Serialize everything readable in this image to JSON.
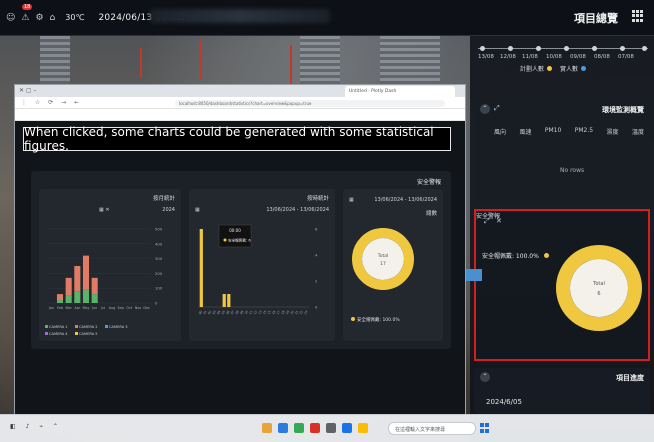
{
  "topbar": {
    "notification_count": "18",
    "weather": "30℃",
    "datetime": "2024/06/13 06:09PM",
    "project_title": "項目總覽"
  },
  "timeline": {
    "labels": [
      "07/08",
      "08/08",
      "09/08",
      "10/08",
      "11/08",
      "12/08",
      "13/08"
    ],
    "legend_a": "計劃人數",
    "legend_b": "實人數"
  },
  "env_card": {
    "title": "環境監測概覽",
    "tabs": [
      "風向",
      "風速",
      "PM10",
      "PM2.5",
      "濕度",
      "溫度"
    ],
    "empty_text": "No rows"
  },
  "safety_card": {
    "title": "安全警報",
    "legend": "安全帽佩戴: 100.0%",
    "center_label": "Total",
    "center_value": "6"
  },
  "progress_card": {
    "title": "項目進度",
    "date": "2024/6/05"
  },
  "browser": {
    "tab_title": "Untitled · Plotly Dash",
    "url": "localhost:8050/dashboard/statistics?chart=overview&popup=true"
  },
  "caption": "When clicked, some charts could be generated with some statistical figures.",
  "stats_panel": {
    "title": "安全警報",
    "card1": {
      "header": "總數",
      "range": "13/06/2024 - 13/06/2024",
      "center_label": "Total",
      "center_value": "17",
      "legend": "安全帽佩戴: 100.0%"
    },
    "card2": {
      "header": "按時統計",
      "range": "13/06/2024 - 13/06/2024",
      "tooltip_title": "00:00",
      "tooltip_text": "安全帽佩戴: 6"
    },
    "card3": {
      "header": "按月統計",
      "year": "2024",
      "legend": [
        "CAMERA 1",
        "CAMERA 2",
        "CAMERA 3",
        "CAMERA 4",
        "CAMERA 5"
      ]
    }
  },
  "taskbar": {
    "search_placeholder": "在這裡輸入文字來搜尋"
  },
  "colors": {
    "accent_yellow": "#f0c840",
    "alert_red": "#d21f1f",
    "arrow_blue": "#4a8fd0",
    "bar_red": "#e07b66",
    "bar_green": "#5bb36a"
  },
  "chart_data": [
    {
      "type": "bar",
      "title": "按時統計",
      "categories": [
        "00",
        "01",
        "02",
        "03",
        "04",
        "05",
        "06",
        "07",
        "08",
        "09",
        "10",
        "11",
        "12",
        "13",
        "14",
        "15",
        "16",
        "17",
        "18",
        "19",
        "20",
        "21",
        "22",
        "23"
      ],
      "values": [
        6,
        0,
        0,
        0,
        0,
        1,
        1,
        0,
        0,
        0,
        0,
        0,
        0,
        0,
        0,
        0,
        0,
        0,
        0,
        0,
        0,
        0,
        0,
        0
      ],
      "ylim": [
        0,
        6
      ]
    },
    {
      "type": "bar",
      "title": "按月統計",
      "categories": [
        "Jan",
        "Feb",
        "Mar",
        "Apr",
        "May",
        "Jun",
        "Jul",
        "Aug",
        "Sep",
        "Oct",
        "Nov",
        "Dec"
      ],
      "series": [
        {
          "name": "CAMERA 1",
          "values": [
            0,
            20,
            50,
            80,
            90,
            60,
            0,
            0,
            0,
            0,
            0,
            0
          ]
        },
        {
          "name": "CAMERA 2",
          "values": [
            0,
            40,
            120,
            170,
            230,
            110,
            0,
            0,
            0,
            0,
            0,
            0
          ]
        }
      ],
      "ylim": [
        0,
        500
      ]
    },
    {
      "type": "pie",
      "title": "總數",
      "categories": [
        "安全帽佩戴"
      ],
      "values": [
        17
      ]
    }
  ]
}
